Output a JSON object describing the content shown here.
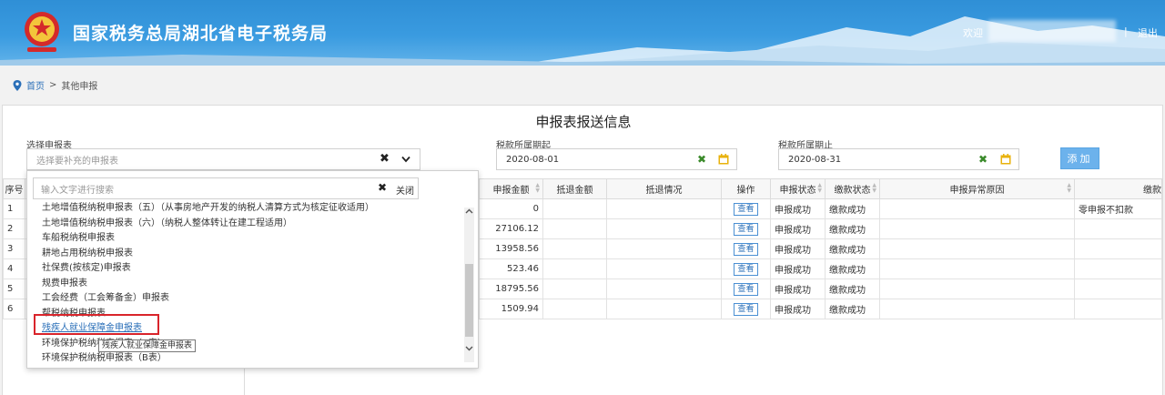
{
  "header": {
    "site_title": "国家税务总局湖北省电子税务局",
    "welcome": "欢迎",
    "separator": "|",
    "logout": "退出"
  },
  "breadcrumb": {
    "home": "首页",
    "arrow": ">",
    "current": "其他申报"
  },
  "panel": {
    "title": "申报表报送信息",
    "select_form": {
      "label": "选择申报表",
      "placeholder": "选择要补充的申报表"
    },
    "period_start": {
      "label": "税款所属期起",
      "value": "2020-08-01"
    },
    "period_end": {
      "label": "税款所属期止",
      "value": "2020-08-31"
    },
    "add_button": "添加"
  },
  "table": {
    "headers": [
      "序号",
      "申报金额",
      "抵退金额",
      "抵退情况",
      "操作",
      "申报状态",
      "缴款状态",
      "申报异常原因",
      "缴款"
    ],
    "rows": [
      {
        "no": "1",
        "amount": "0",
        "action": "查看",
        "decl_status": "申报成功",
        "pay_status": "缴款成功",
        "note": "零申报不扣款"
      },
      {
        "no": "2",
        "amount": "27106.12",
        "action": "查看",
        "decl_status": "申报成功",
        "pay_status": "缴款成功",
        "note": ""
      },
      {
        "no": "3",
        "amount": "13958.56",
        "action": "查看",
        "decl_status": "申报成功",
        "pay_status": "缴款成功",
        "note": ""
      },
      {
        "no": "4",
        "amount": "523.46",
        "action": "查看",
        "decl_status": "申报成功",
        "pay_status": "缴款成功",
        "note": ""
      },
      {
        "no": "5",
        "amount": "18795.56",
        "action": "查看",
        "decl_status": "申报成功",
        "pay_status": "缴款成功",
        "note": ""
      },
      {
        "no": "6",
        "amount": "1509.94",
        "action": "查看",
        "decl_status": "申报成功",
        "pay_status": "缴款成功",
        "note": ""
      }
    ]
  },
  "dropdown": {
    "search_placeholder": "输入文字进行搜索",
    "close": "关闭",
    "items": [
      "土地增值税纳税申报表（五）（从事房地产开发的纳税人清算方式为核定征收适用）",
      "土地增值税纳税申报表（六）（纳税人整体转让在建工程适用）",
      "车船税纳税申报表",
      "耕地占用税纳税申报表",
      "社保费(按核定)申报表",
      "规费申报表",
      "工会经费（工会筹备金）申报表",
      "帮税纳税申报表",
      "残疾人就业保障金申报表",
      "环境保护税纳税申报表（A表）",
      "环境保护税纳税申报表（B表）"
    ],
    "tooltip": "残疾人就业保障金申报表"
  },
  "colors": {
    "header_blue": "#3a9be0",
    "link_blue": "#2a6fb8",
    "highlight_red": "#d9242b",
    "button_blue": "#6cb2ec"
  }
}
